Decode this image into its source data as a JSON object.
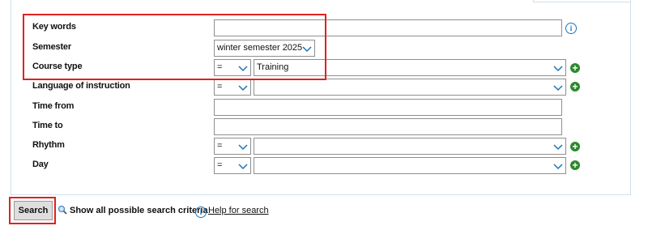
{
  "form": {
    "keywords": {
      "label": "Key words",
      "value": ""
    },
    "semester": {
      "label": "Semester",
      "value": "winter semester 2025"
    },
    "course_type": {
      "label": "Course type",
      "operator": "=",
      "value": "Training"
    },
    "language": {
      "label": "Language of instruction",
      "operator": "=",
      "value": ""
    },
    "time_from": {
      "label": "Time from",
      "value": ""
    },
    "time_to": {
      "label": "Time to",
      "value": ""
    },
    "rhythm": {
      "label": "Rhythm",
      "operator": "=",
      "value": ""
    },
    "day": {
      "label": "Day",
      "operator": "=",
      "value": ""
    }
  },
  "actions": {
    "search_label": "Search",
    "show_all_label": "Show all possible search criteria",
    "help_label": "Help for search"
  },
  "colors": {
    "highlight": "#dd2222",
    "add_icon": "#2d8a2d",
    "info_icon": "#1a74b8",
    "chevron": "#1a74b8"
  }
}
